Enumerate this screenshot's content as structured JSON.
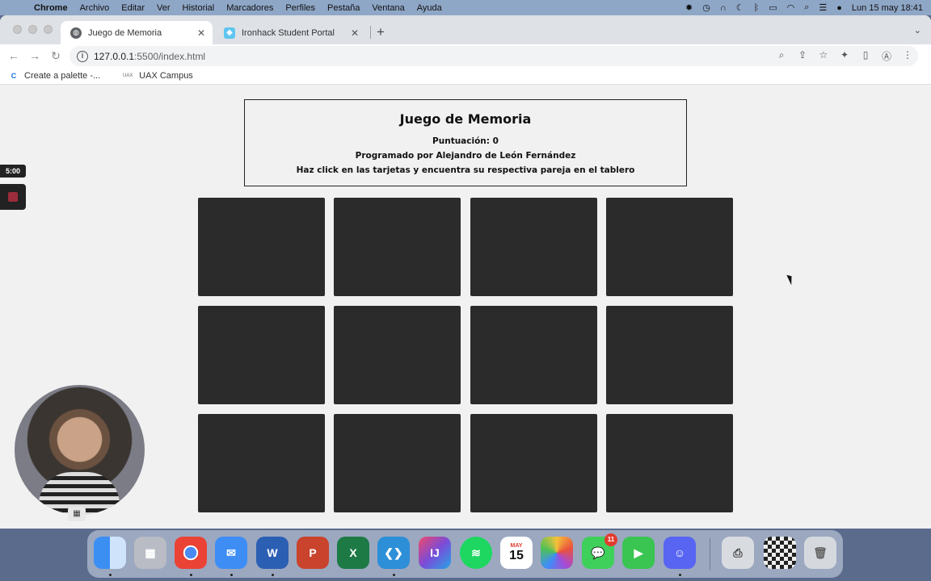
{
  "menubar": {
    "app": "Chrome",
    "items": [
      "Archivo",
      "Editar",
      "Ver",
      "Historial",
      "Marcadores",
      "Perfiles",
      "Pestaña",
      "Ventana",
      "Ayuda"
    ],
    "clock": "Lun 15 may  18:41"
  },
  "tabs": [
    {
      "title": "Juego de Memoria"
    },
    {
      "title": "Ironhack Student Portal"
    }
  ],
  "address": {
    "host": "127.0.0.1",
    "rest": ":5500/index.html"
  },
  "bookmarks": [
    {
      "label": "Create a palette -..."
    },
    {
      "label": "UAX Campus"
    }
  ],
  "page": {
    "title": "Juego de Memoria",
    "score": "Puntuación: 0",
    "author": "Programado por Alejandro de León Fernández",
    "instructions": "Haz click en las tarjetas y encuentra su respectiva pareja en el tablero"
  },
  "overlay": {
    "timer": "5:00"
  },
  "dock": {
    "calendar_month": "MAY",
    "calendar_day": "15",
    "messages_badge": "11"
  }
}
